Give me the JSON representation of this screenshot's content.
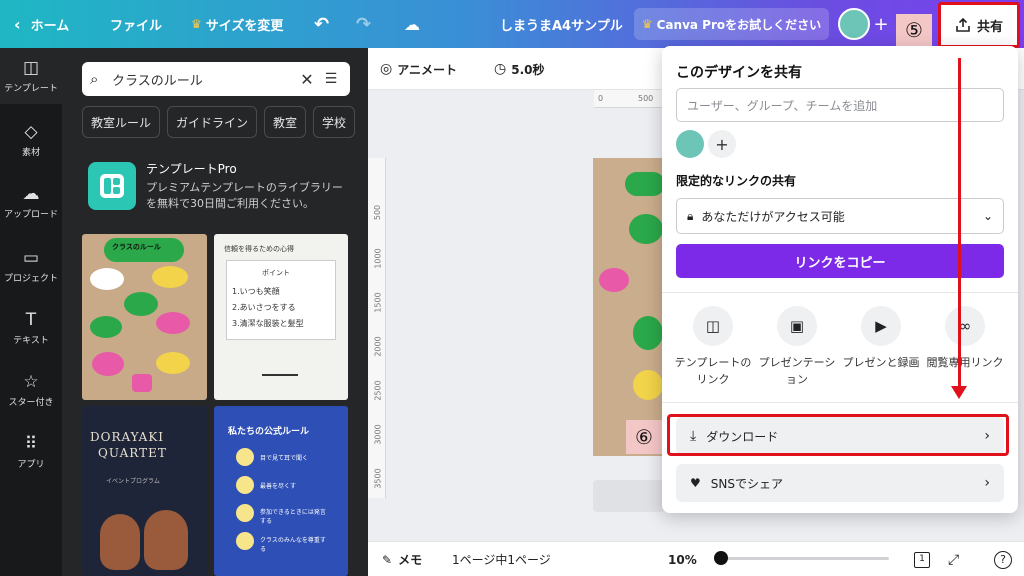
{
  "topbar": {
    "home": "ホーム",
    "file": "ファイル",
    "resize": "サイズを変更",
    "doc_title": "しまうまA4サンプル",
    "pro_trial": "Canva Proをお試しください",
    "share": "共有",
    "step5": "⑤"
  },
  "rail": {
    "items": [
      {
        "label": "テンプレート"
      },
      {
        "label": "素材"
      },
      {
        "label": "アップロード"
      },
      {
        "label": "プロジェクト"
      },
      {
        "label": "テキスト"
      },
      {
        "label": "スター付き"
      },
      {
        "label": "アプリ"
      }
    ]
  },
  "panel": {
    "search_value": "クラスのルール",
    "chips": [
      "教室ルール",
      "ガイドライン",
      "教室",
      "学校"
    ],
    "promo_title": "テンプレートPro",
    "promo_desc": "プレミアムテンプレートのライブラリーを無料で30日間ご利用ください。",
    "thumbs": {
      "t1_title": "クラスのルール",
      "t2_title": "信頼を得るための心得",
      "t2_point": "ポイント",
      "t2_l1": "1.いつも笑顔",
      "t2_l2": "2.あいさつをする",
      "t2_l3": "3.清潔な服装と髪型",
      "t3_line1": "DORAYAKI",
      "t3_line2": "QUARTET",
      "t3_sub": "イベントプログラム",
      "t4_title": "私たちの公式ルール",
      "t4_r1": "目で見て耳で聞く",
      "t4_r2": "最善を尽くす",
      "t4_r3": "参加できるときには発言する",
      "t4_r4": "クラスのみんなを尊重する"
    }
  },
  "editor": {
    "animate": "アニメート",
    "duration": "5.0秒",
    "ruler_top": [
      "0",
      "500"
    ],
    "ruler_left": [
      "500",
      "1000",
      "1500",
      "2000",
      "2500",
      "3000",
      "3500"
    ],
    "step6": "⑥"
  },
  "bottom": {
    "notes": "メモ",
    "page_count": "1ページ中1ページ",
    "zoom": "10%",
    "pages": "1",
    "help": "?",
    "zoom_level": 0.0
  },
  "share_popup": {
    "title": "このデザインを共有",
    "people_placeholder": "ユーザー、グループ、チームを追加",
    "restricted_label": "限定的なリンクの共有",
    "access": "あなただけがアクセス可能",
    "copy_link": "リンクをコピー",
    "options": [
      {
        "label": "テンプレートのリンク"
      },
      {
        "label": "プレゼンテーション"
      },
      {
        "label": "プレゼンと録画"
      },
      {
        "label": "閲覧専用リンク"
      }
    ],
    "download": "ダウンロード",
    "social": "SNSでシェア"
  },
  "colors": {
    "accent_purple": "#7d2ae8",
    "highlight_red": "#e0101c",
    "step_badge_bg": "#f4c7c7"
  }
}
